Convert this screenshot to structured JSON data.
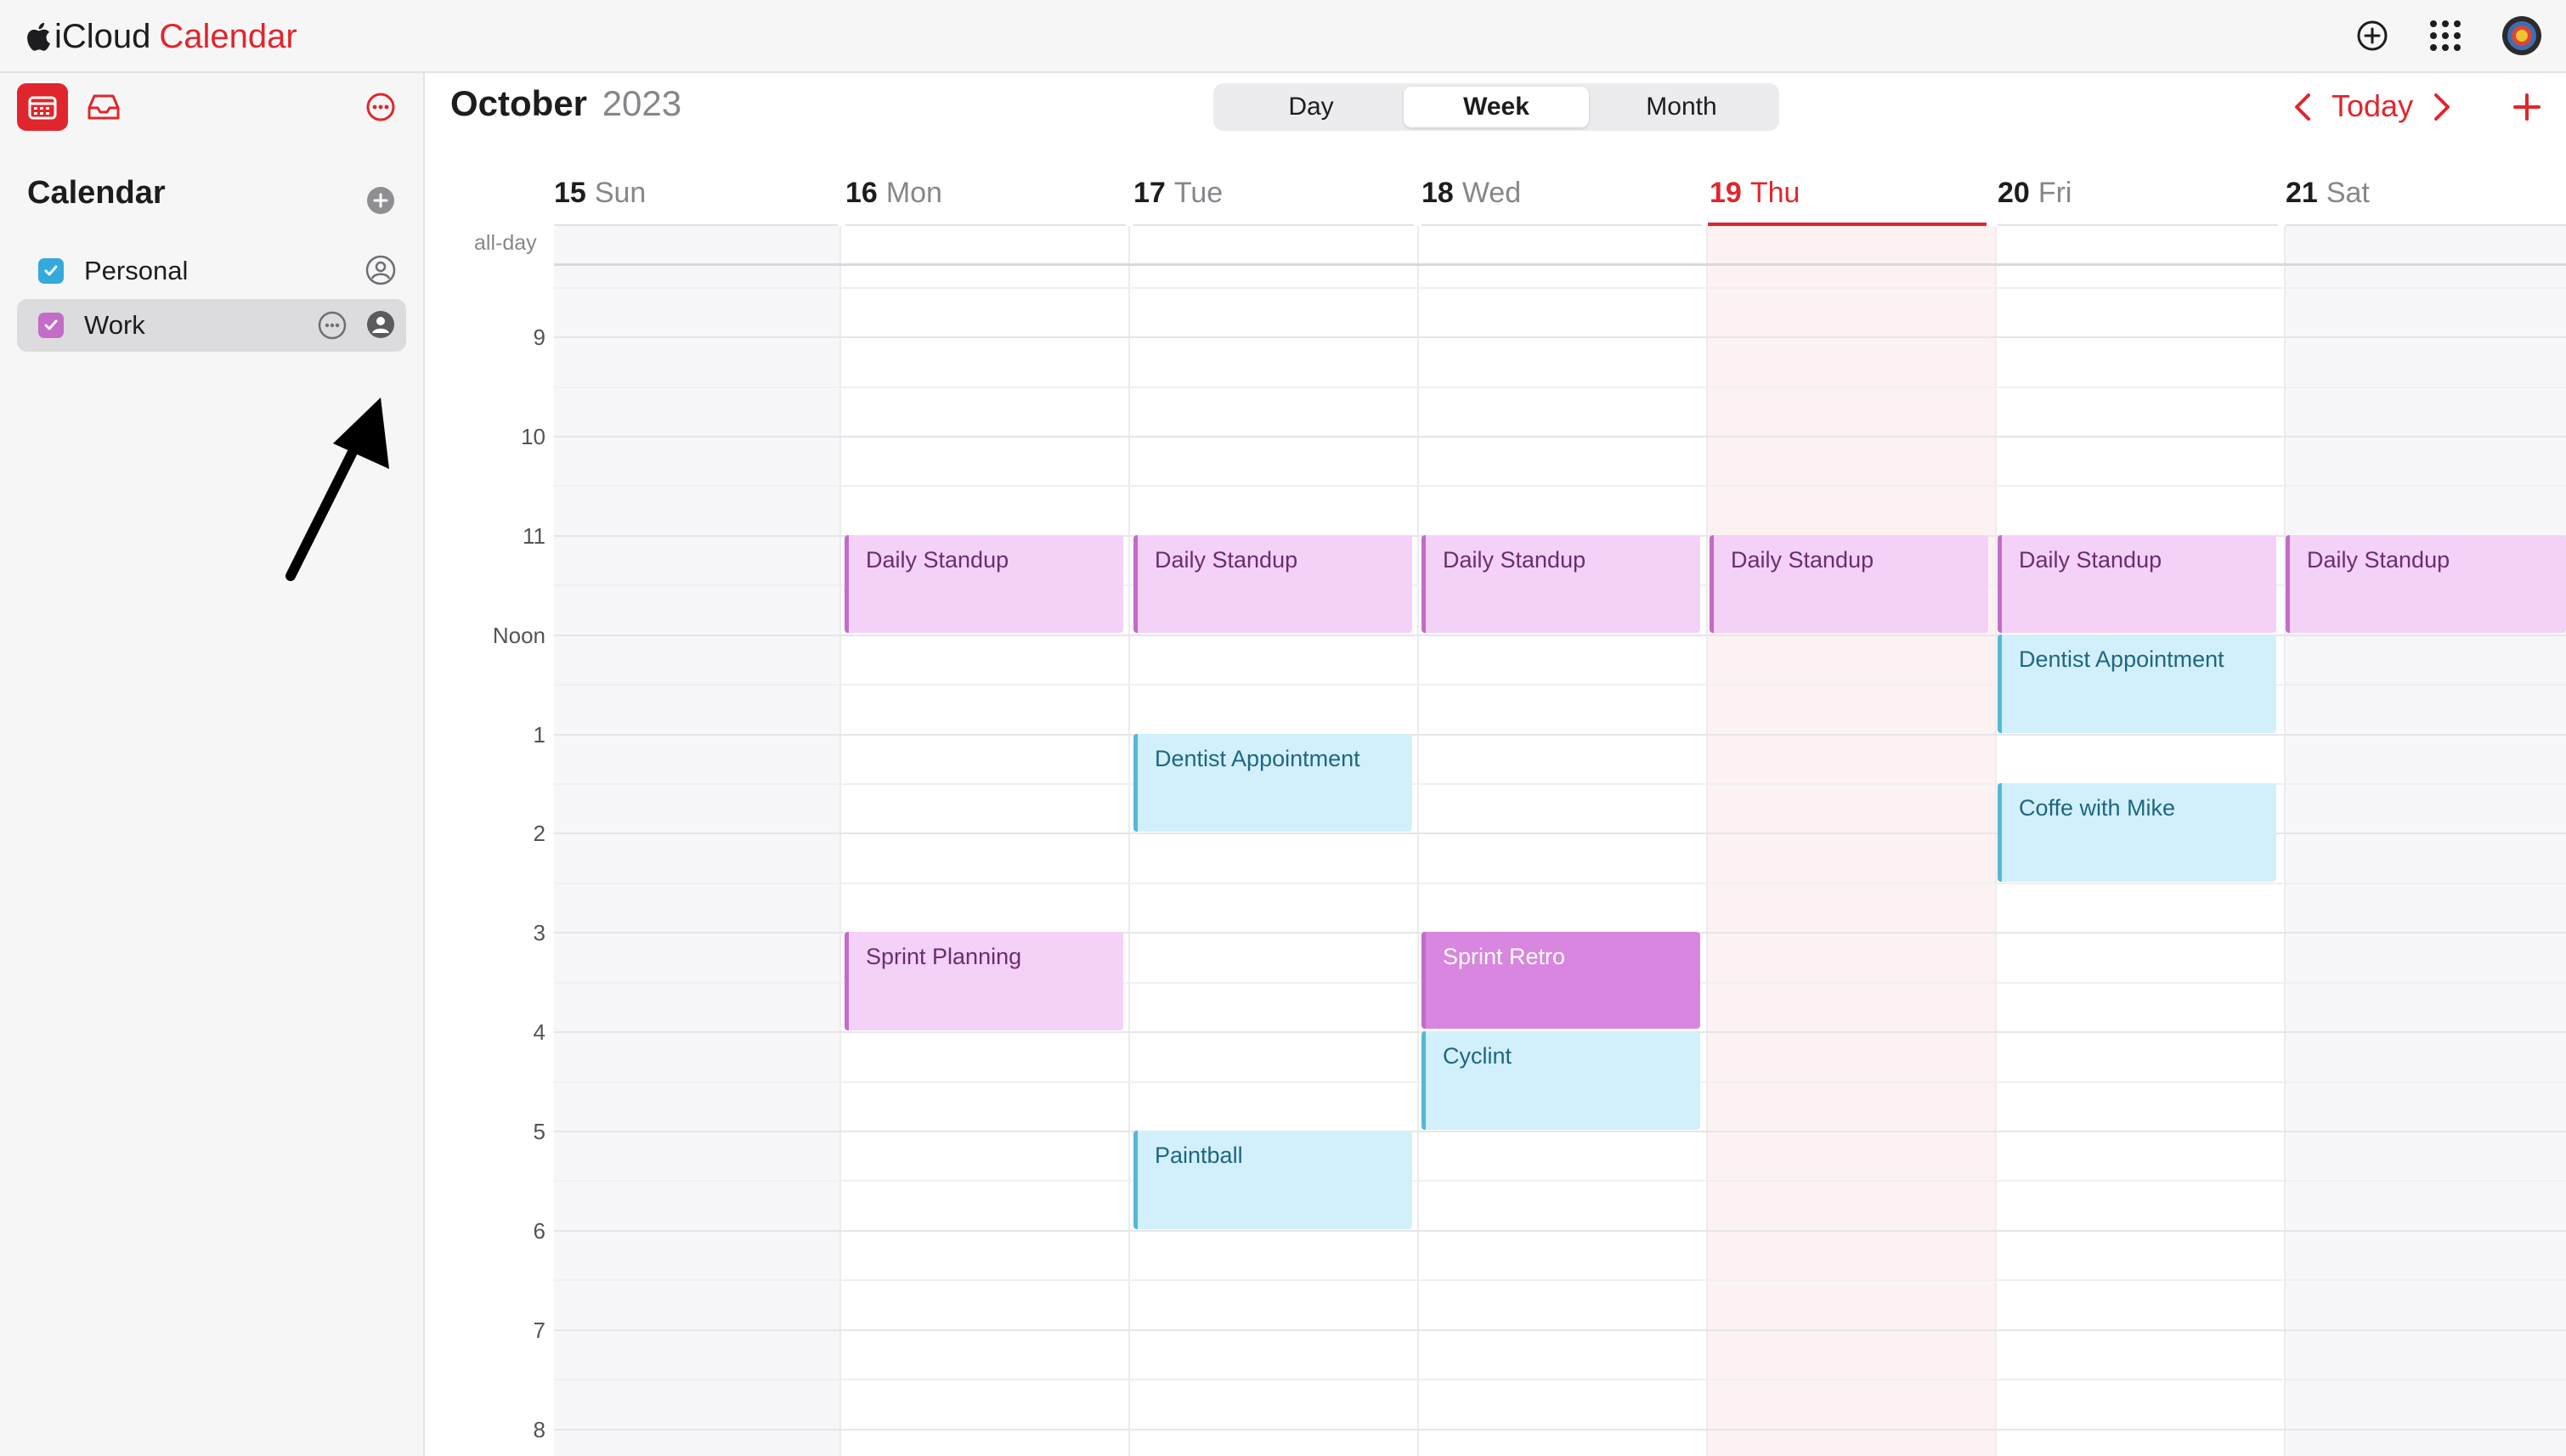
{
  "app": {
    "brand_text": "iCloud",
    "brand_accent": "Calendar"
  },
  "colors": {
    "accent": "#e0262c",
    "work": "#c36cc8",
    "personal": "#55b7d6"
  },
  "topbar": {
    "icons": [
      "add-circle-icon",
      "app-grid-icon",
      "account-avatar-icon"
    ]
  },
  "sidebar": {
    "title": "Calendar",
    "calendars": [
      {
        "name": "Personal",
        "color": "#34aadc",
        "checked": true
      },
      {
        "name": "Work",
        "color": "#c36cc8",
        "checked": true,
        "selected": true
      }
    ]
  },
  "header": {
    "month": "October",
    "year": "2023"
  },
  "view_switch": {
    "options": [
      "Day",
      "Week",
      "Month"
    ],
    "selected": "Week"
  },
  "nav": {
    "today_label": "Today"
  },
  "days": [
    {
      "num": "15",
      "name": "Sun"
    },
    {
      "num": "16",
      "name": "Mon"
    },
    {
      "num": "17",
      "name": "Tue"
    },
    {
      "num": "18",
      "name": "Wed"
    },
    {
      "num": "19",
      "name": "Thu",
      "today": true
    },
    {
      "num": "20",
      "name": "Fri"
    },
    {
      "num": "21",
      "name": "Sat"
    }
  ],
  "allday_label": "all-day",
  "hours": [
    "9",
    "10",
    "11",
    "Noon",
    "1",
    "2",
    "3",
    "4",
    "5",
    "6",
    "7",
    "8"
  ],
  "events": [
    {
      "title": "Daily Standup",
      "day": "16 Mon",
      "calendar": "Work"
    },
    {
      "title": "Daily Standup",
      "day": "17 Tue",
      "calendar": "Work"
    },
    {
      "title": "Daily Standup",
      "day": "18 Wed",
      "calendar": "Work"
    },
    {
      "title": "Daily Standup",
      "day": "19 Thu",
      "calendar": "Work"
    },
    {
      "title": "Daily Standup",
      "day": "20 Fri",
      "calendar": "Work"
    },
    {
      "title": "Daily Standup",
      "day": "21 Sat",
      "calendar": "Work"
    },
    {
      "title": "Dentist Appointment",
      "day": "20 Fri",
      "calendar": "Personal"
    },
    {
      "title": "Dentist Appointment",
      "day": "17 Tue",
      "calendar": "Personal"
    },
    {
      "title": "Coffe with Mike",
      "day": "20 Fri",
      "calendar": "Personal"
    },
    {
      "title": "Sprint Planning",
      "day": "16 Mon",
      "calendar": "Work"
    },
    {
      "title": "Sprint Retro",
      "day": "18 Wed",
      "calendar": "Work"
    },
    {
      "title": "Cyclint",
      "day": "18 Wed",
      "calendar": "Personal"
    },
    {
      "title": "Paintball",
      "day": "17 Tue",
      "calendar": "Personal"
    }
  ]
}
